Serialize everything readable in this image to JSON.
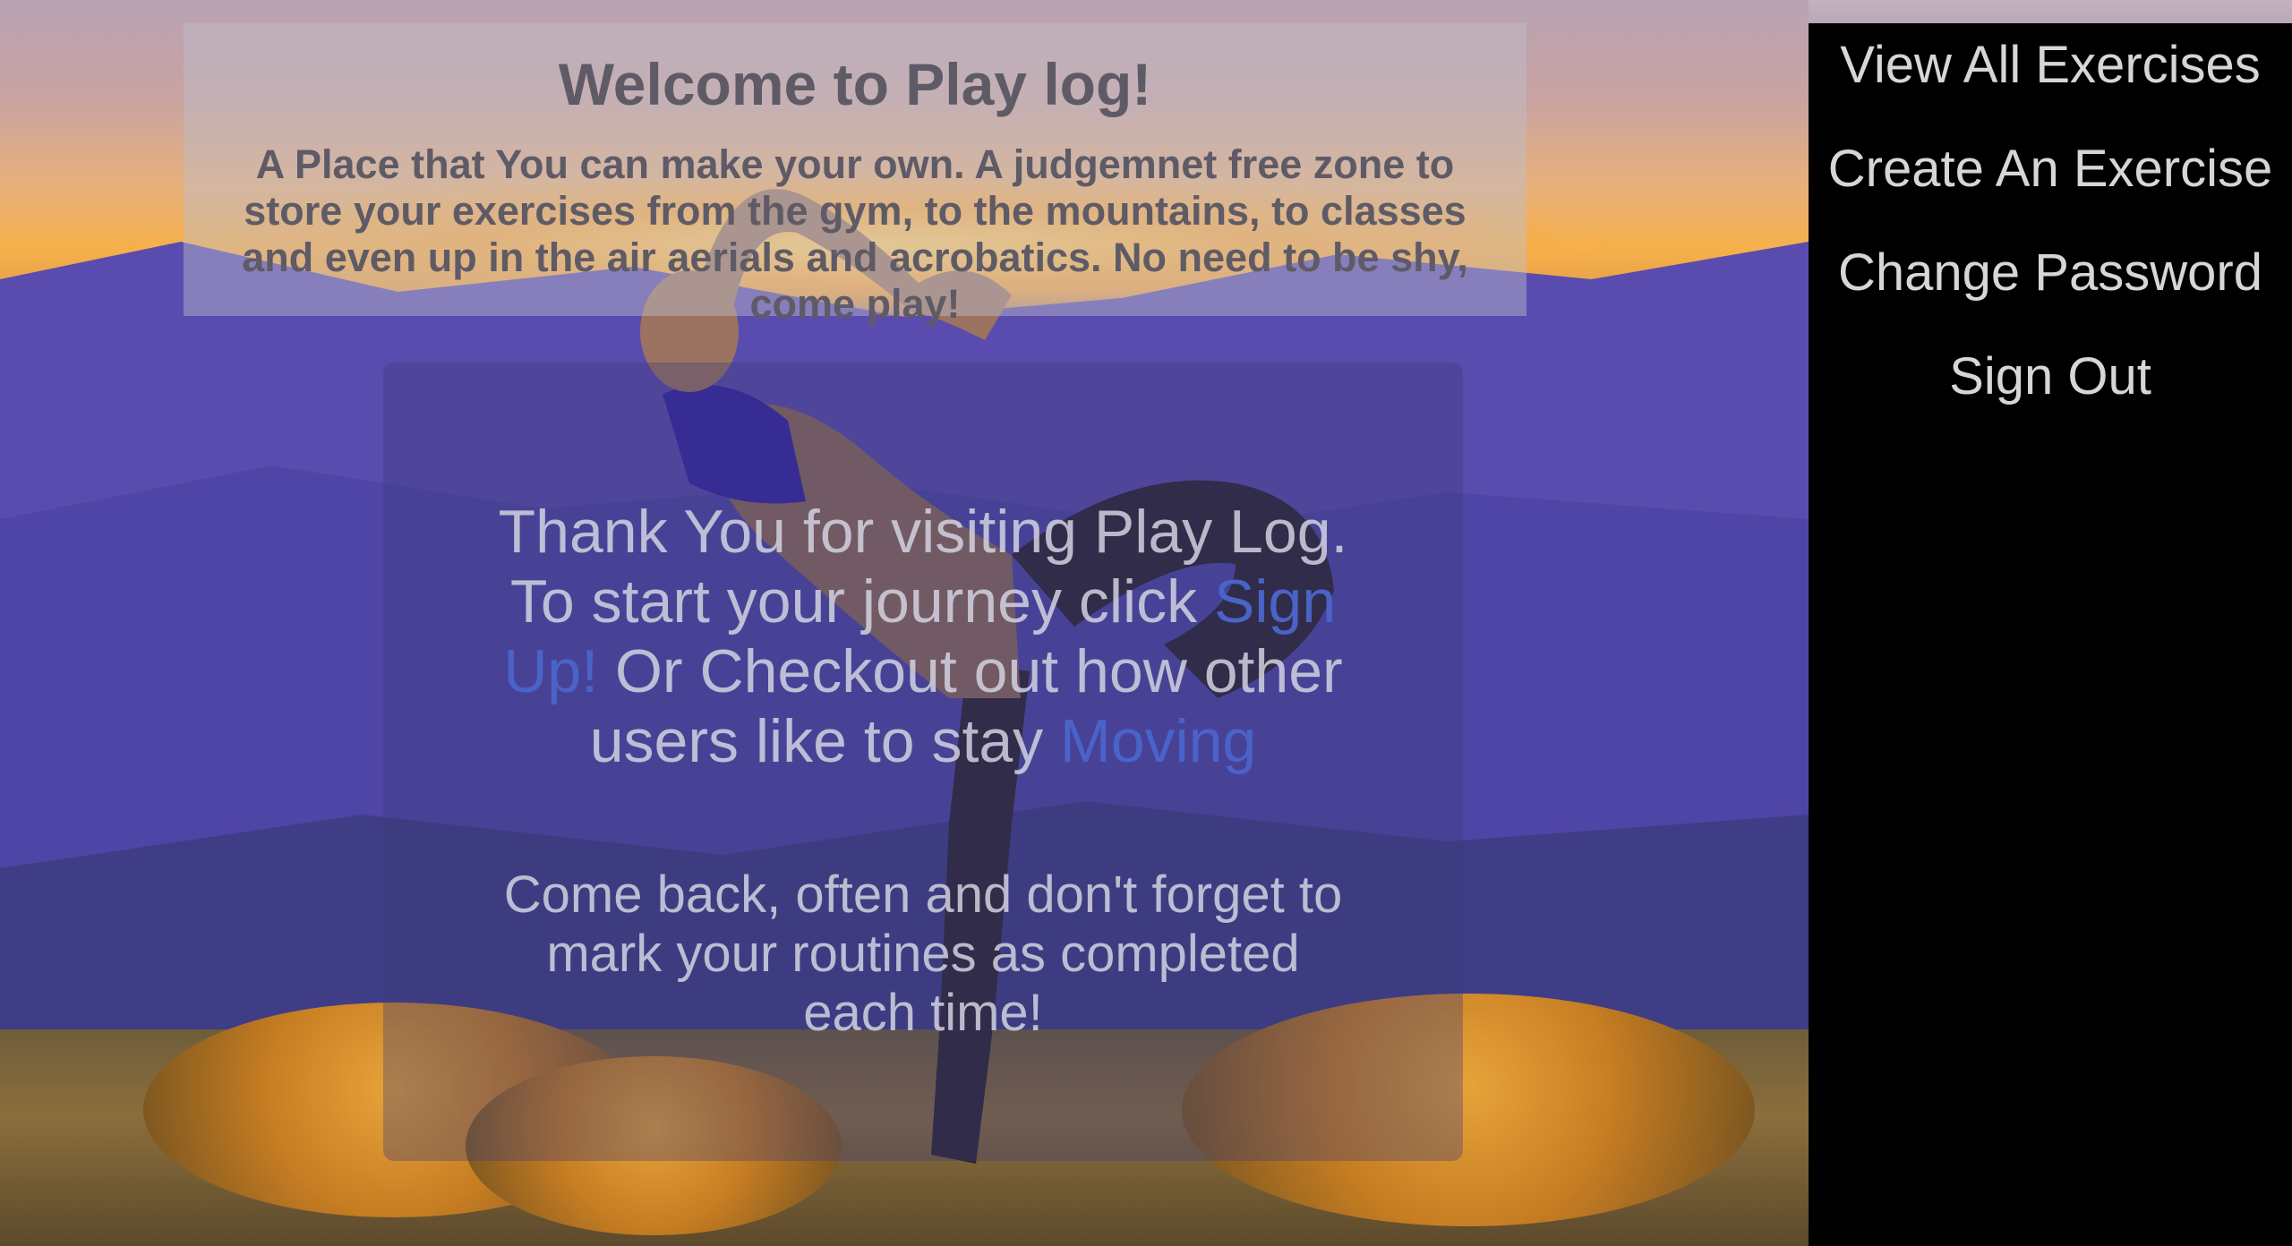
{
  "welcome": {
    "title": "Welcome to Play log!",
    "text": "A Place that You can make your own. A judgemnet free zone to store your exercises from the gym, to the mountains, to classes and even up in the air aerials and acrobatics. No need to be shy, come play!"
  },
  "main": {
    "intro_part1": "Thank You for visiting Play Log. To start your journey click ",
    "signup_link": "Sign Up!",
    "intro_part2": " Or Checkout out how other users like to stay ",
    "moving_link": "Moving",
    "reminder": "Come back, often and don't forget to mark your routines as completed each time!"
  },
  "nav": {
    "items": [
      {
        "label": "View All Exercises"
      },
      {
        "label": "Create An Exercise"
      },
      {
        "label": "Change Password"
      },
      {
        "label": "Sign Out"
      }
    ]
  },
  "colors": {
    "nav_background": "#000000",
    "nav_text": "#d6d6d6",
    "link": "#4a63c9"
  },
  "icons": []
}
